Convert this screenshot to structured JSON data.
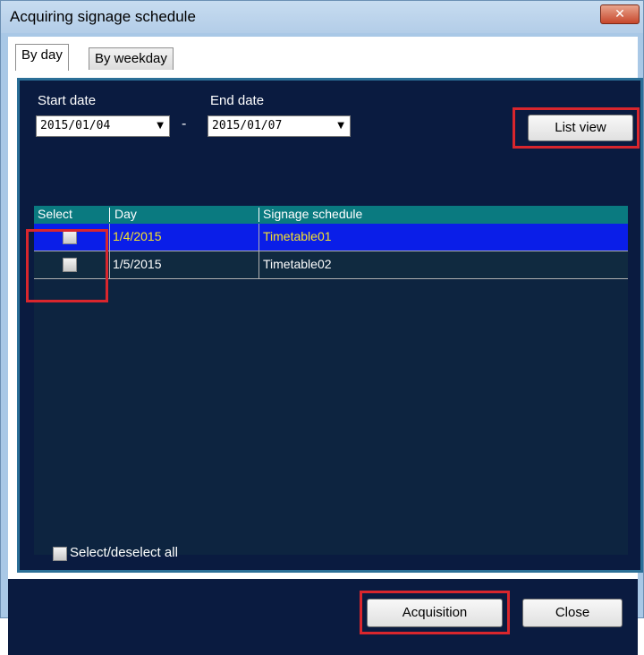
{
  "window": {
    "title": "Acquiring signage schedule",
    "close_glyph": "✕"
  },
  "tabs": [
    {
      "label": "By day",
      "active": true
    },
    {
      "label": "By weekday",
      "active": false
    }
  ],
  "filters": {
    "start_label": "Start date",
    "start_value": "2015/01/04",
    "separator": "-",
    "end_label": "End date",
    "end_value": "2015/01/07",
    "dropdown_glyph": "▼",
    "list_view_label": "List view"
  },
  "table": {
    "columns": [
      "Select",
      "Day",
      "Signage schedule"
    ],
    "rows": [
      {
        "checked": false,
        "day": "1/4/2015",
        "schedule": "Timetable01",
        "selected": true
      },
      {
        "checked": false,
        "day": "1/5/2015",
        "schedule": "Timetable02",
        "selected": false
      }
    ]
  },
  "select_all_label": "Select/deselect all",
  "buttons": {
    "acquisition": "Acquisition",
    "close": "Close"
  },
  "colors": {
    "highlight_row": "#0a1ee8",
    "highlight_text": "#f7e22a",
    "panel_bg": "#0a1b40",
    "header_bg": "#0a7a80",
    "annotation_red": "#d9262d"
  }
}
